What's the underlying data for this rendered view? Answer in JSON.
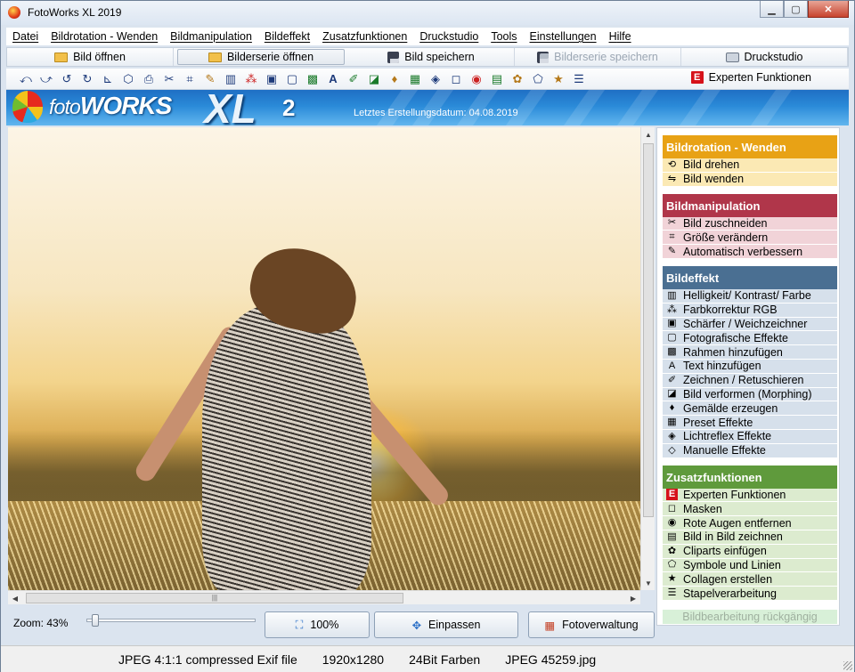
{
  "window": {
    "title": "FotoWorks XL 2019"
  },
  "menu": [
    "Datei",
    "Bildrotation - Wenden",
    "Bildmanipulation",
    "Bildeffekt",
    "Zusatzfunktionen",
    "Druckstudio",
    "Tools",
    "Einstellungen",
    "Hilfe"
  ],
  "actions": {
    "open_image": "Bild öffnen",
    "open_series": "Bilderserie öffnen",
    "save_image": "Bild speichern",
    "save_series": "Bilderserie speichern",
    "print_studio": "Druckstudio"
  },
  "toolbar": {
    "expert_label": "Experten Funktionen",
    "expert_icon_letter": "E",
    "icons": [
      "rotate-left-icon",
      "rotate-right-icon",
      "undo-rotate-icon",
      "redo-rotate-icon",
      "straighten-icon",
      "cube-icon",
      "printer-small-icon",
      "scissors-icon",
      "crop-icon",
      "wand-icon",
      "levels-icon",
      "rgb-icon",
      "sharpen-icon",
      "photo-effect-icon",
      "frame-icon",
      "text-icon",
      "draw-icon",
      "morph-icon",
      "paint-icon",
      "preset-icon",
      "lightroom-icon",
      "manual-icon",
      "mask-icon",
      "red-eye-icon",
      "picture-in-picture-icon",
      "clipart-icon",
      "symbol-icon",
      "star-icon",
      "batch-icon"
    ]
  },
  "banner": {
    "logo_foto": "foto",
    "logo_works": "WORKS",
    "logo_xl": "XL",
    "logo_version": "2",
    "date_text": "Letztes Erstellungsdatum: 04.08.2019"
  },
  "zoom": {
    "label": "Zoom: 43%",
    "value_percent": 43,
    "btn_100": "100%",
    "btn_fit": "Einpassen",
    "btn_manage": "Fotoverwaltung"
  },
  "sidebar": {
    "sections": [
      {
        "title": "Bildrotation - Wenden",
        "color": "#e8a215",
        "item_bg": "#fbe9b4",
        "items": [
          {
            "label": "Bild drehen",
            "icon": "rotate-icon"
          },
          {
            "label": "Bild wenden",
            "icon": "flip-icon"
          }
        ]
      },
      {
        "title": "Bildmanipulation",
        "color": "#b0364a",
        "item_bg": "#f1d3d8",
        "items": [
          {
            "label": "Bild zuschneiden",
            "icon": "scissors-icon"
          },
          {
            "label": "Größe verändern",
            "icon": "resize-icon"
          },
          {
            "label": "Automatisch verbessern",
            "icon": "wand-icon"
          }
        ]
      },
      {
        "title": "Bildeffekt",
        "color": "#4a6f92",
        "item_bg": "#d6e0eb",
        "items": [
          {
            "label": "Helligkeit/ Kontrast/ Farbe",
            "icon": "levels-icon"
          },
          {
            "label": "Farbkorrektur RGB",
            "icon": "rgb-icon"
          },
          {
            "label": "Schärfer / Weichzeichner",
            "icon": "sharpen-icon"
          },
          {
            "label": "Fotografische Effekte",
            "icon": "photo-effect-icon"
          },
          {
            "label": "Rahmen hinzufügen",
            "icon": "frame-icon"
          },
          {
            "label": "Text hinzufügen",
            "icon": "text-icon"
          },
          {
            "label": "Zeichnen / Retuschieren",
            "icon": "draw-icon"
          },
          {
            "label": "Bild verformen (Morphing)",
            "icon": "morph-icon"
          },
          {
            "label": "Gemälde erzeugen",
            "icon": "paint-icon"
          },
          {
            "label": "Preset Effekte",
            "icon": "preset-icon"
          },
          {
            "label": "Lichtreflex Effekte",
            "icon": "lightreflex-icon"
          },
          {
            "label": "Manuelle Effekte",
            "icon": "manual-icon"
          }
        ]
      },
      {
        "title": "Zusatzfunktionen",
        "color": "#5f9a3c",
        "item_bg": "#dcebcf",
        "items": [
          {
            "label": "Experten Funktionen",
            "icon": "expert-icon"
          },
          {
            "label": "Masken",
            "icon": "mask-icon"
          },
          {
            "label": "Rote Augen entfernen",
            "icon": "red-eye-icon"
          },
          {
            "label": "Bild in Bild zeichnen",
            "icon": "picture-in-picture-icon"
          },
          {
            "label": "Cliparts einfügen",
            "icon": "clipart-icon"
          },
          {
            "label": "Symbole und Linien",
            "icon": "symbol-icon"
          },
          {
            "label": "Collagen erstellen",
            "icon": "star-icon"
          },
          {
            "label": "Stapelverarbeitung",
            "icon": "batch-icon"
          }
        ]
      }
    ],
    "undo": "Bildbearbeitung rückgängig"
  },
  "status": {
    "format": "JPEG 4:1:1 compressed Exif file",
    "dimensions": "1920x1280",
    "colors": "24Bit Farben",
    "filename": "JPEG 45259.jpg"
  }
}
